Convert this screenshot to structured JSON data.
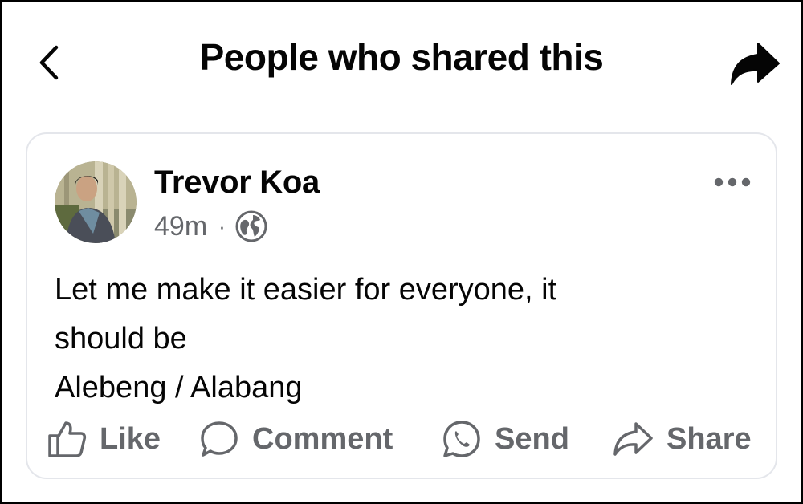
{
  "header": {
    "title": "People who shared this",
    "back_icon": "chevron-left-icon",
    "share_icon": "share-arrow-icon"
  },
  "post": {
    "author": "Trevor Koa",
    "time": "49m",
    "separator": "·",
    "audience_icon": "globe-icon",
    "more_icon": "more-horizontal-icon",
    "text_lines": [
      "Let me make it easier for everyone, it",
      "should be",
      "Alebeng / Alabang"
    ]
  },
  "actions": {
    "like": "Like",
    "comment": "Comment",
    "send": "Send",
    "share": "Share"
  },
  "colors": {
    "text_primary": "#050505",
    "text_secondary": "#65676b",
    "card_border": "#e4e6eb"
  }
}
